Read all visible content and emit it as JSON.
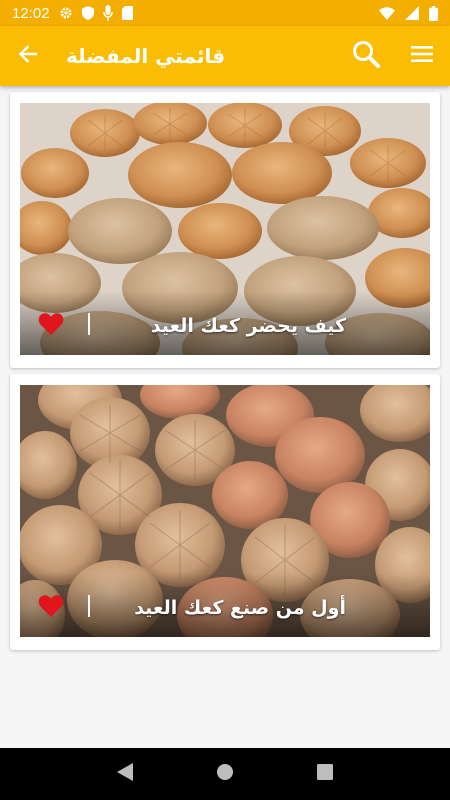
{
  "status_bar": {
    "time": "12:02",
    "icons": [
      "settings-icon",
      "shield-icon",
      "microphone-icon",
      "sd-card-icon",
      "wifi-icon",
      "signal-icon",
      "battery-icon"
    ]
  },
  "app_bar": {
    "title": "قائمتي المفضلة",
    "back_icon": "arrow-back-icon",
    "search_icon": "search-icon",
    "menu_icon": "menu-icon",
    "background": "#fbbd04"
  },
  "favorites": [
    {
      "title": "كيف يحضر كعك العيد",
      "favorited": true,
      "image": "kaak-cookies-photo"
    },
    {
      "title": "أول من صنع كعك العيد",
      "favorited": true,
      "image": "kaak-cookies-photo"
    }
  ],
  "nav_bar": {
    "back_icon": "nav-back-icon",
    "home_icon": "nav-home-icon",
    "recents_icon": "nav-recents-icon"
  },
  "colors": {
    "heart": "#e0161c",
    "status_bar": "#f4ae00"
  }
}
